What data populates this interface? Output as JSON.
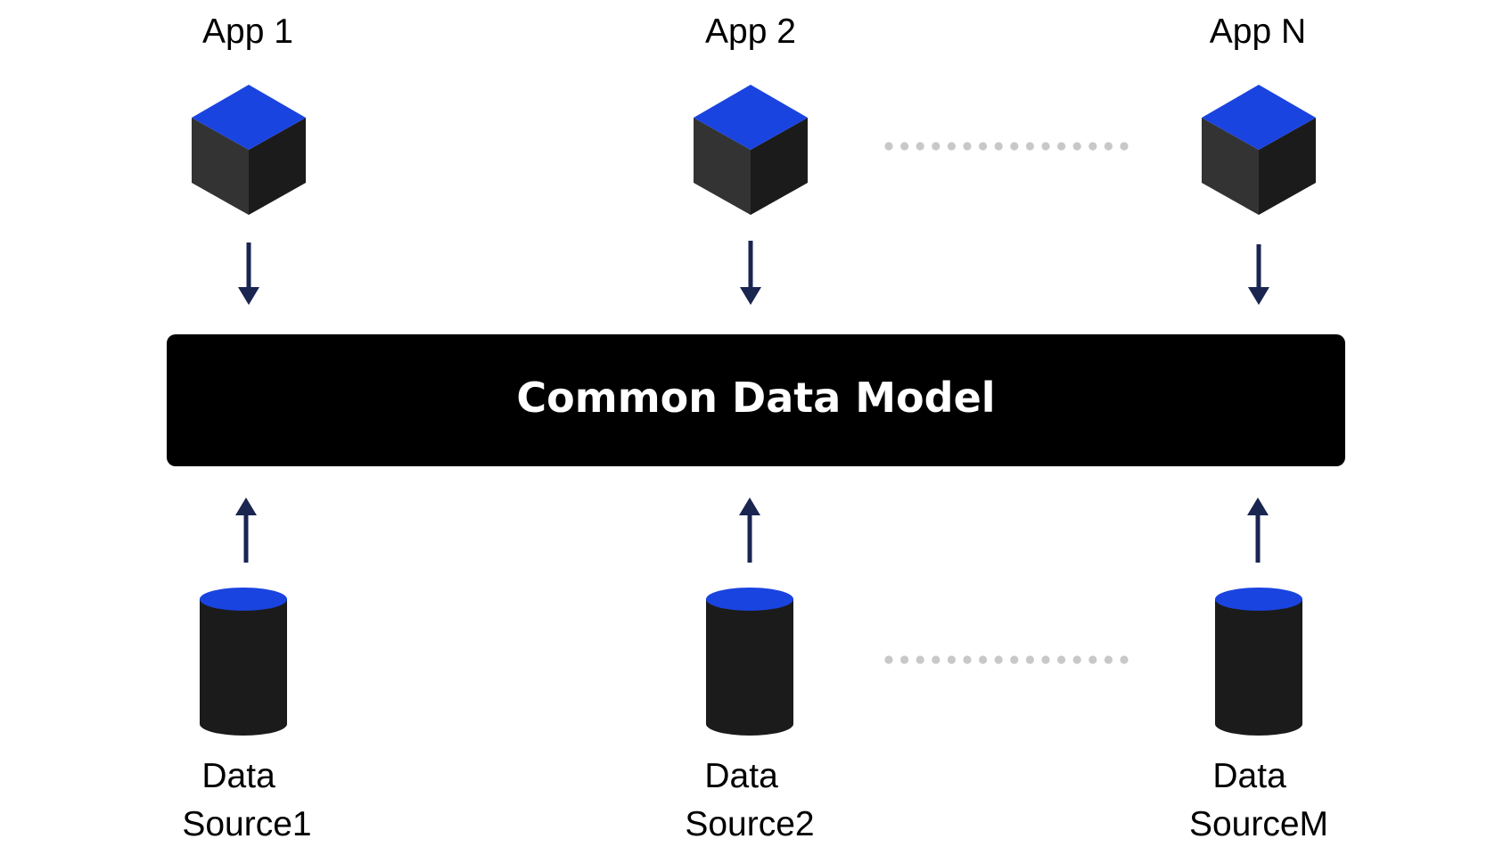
{
  "colors": {
    "accent_blue": "#1A44E0",
    "cube_left": "#333333",
    "cube_right": "#1B1B1B",
    "cylinder_body": "#1B1B1B",
    "hub_background": "#000000",
    "hub_text": "#FFFFFF",
    "arrow": "#1A2550",
    "dots": "#C8C8C8",
    "background": "#FFFFFF"
  },
  "apps": [
    {
      "label": "App 1",
      "icon": "cube-icon"
    },
    {
      "label": "App 2",
      "icon": "cube-icon"
    },
    {
      "label": "App N",
      "icon": "cube-icon"
    }
  ],
  "hub": {
    "label": "Common Data Model"
  },
  "sources": [
    {
      "line1": "Data",
      "line2": "Source1",
      "icon": "database-cylinder-icon"
    },
    {
      "line1": "Data",
      "line2": "Source2",
      "icon": "database-cylinder-icon"
    },
    {
      "line1": "Data",
      "line2": "SourceM",
      "icon": "database-cylinder-icon"
    }
  ],
  "arrows": {
    "app_to_hub": "down",
    "source_to_hub": "up"
  },
  "ellipsis": {
    "apps_row": "dotted-continuation",
    "sources_row": "dotted-continuation"
  }
}
